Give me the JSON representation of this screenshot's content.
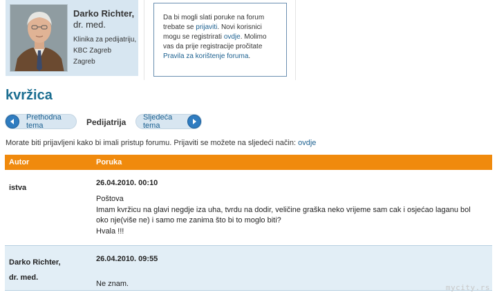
{
  "doctor": {
    "name": "Darko Richter,",
    "title": "dr. med.",
    "clinic_line1": "Klinika za pedijatriju,",
    "clinic_line2": "KBC Zagreb",
    "clinic_line3": "Zagreb",
    "photo_icon": "doctor-portrait"
  },
  "notice": {
    "text1": "Da bi mogli slati poruke na forum trebate se ",
    "link1": "prijaviti",
    "text2": ". Novi korisnici mogu se registrirati ",
    "link2": "ovdje",
    "text3": ". Molimo vas da prije registracije pročitate ",
    "link3": "Pravila za korištenje foruma",
    "text4": "."
  },
  "topic": {
    "title": "kvržica"
  },
  "nav": {
    "prev_label": "Prethodna tema",
    "category": "Pedijatrija",
    "next_label": "Sljedeća tema",
    "prev_icon": "arrow-left-icon",
    "next_icon": "arrow-right-icon"
  },
  "login_notice": {
    "text": "Morate biti prijavljeni kako bi imali pristup forumu. Prijaviti se možete na sljedeći način: ",
    "link": "ovdje"
  },
  "table": {
    "headers": {
      "author": "Autor",
      "post": "Poruka"
    },
    "posts": [
      {
        "author_line1": "istva",
        "author_line2": "",
        "date": "26.04.2010. 00:10",
        "body": [
          "Poštova",
          "Imam kvržicu na glavi negdje iza uha, tvrdu na dodir, veličine graška neko vrijeme sam cak i osjećao laganu bol",
          "oko nje(više ne) i samo me zanima što bi to moglo biti?",
          "Hvala !!!"
        ]
      },
      {
        "author_line1": "Darko Richter,",
        "author_line2": "dr. med.",
        "date": "26.04.2010. 09:55",
        "body": [
          "Ne znam."
        ]
      }
    ]
  },
  "watermark": "mycity.rs",
  "colors": {
    "header_orange": "#f08a0d",
    "link_blue": "#1a5f8f",
    "title_blue": "#1a6d90",
    "card_bg": "#d7e6f1",
    "row_alt_bg": "#e2eef6"
  }
}
